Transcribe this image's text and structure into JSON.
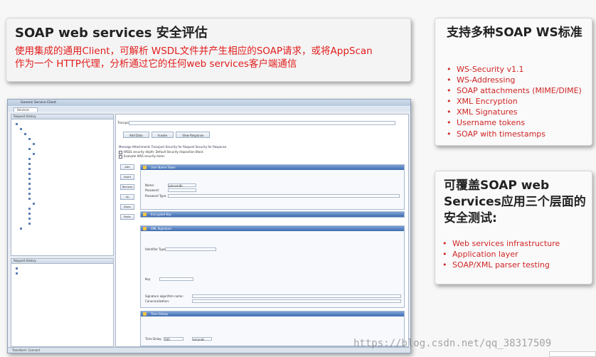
{
  "main_panel": {
    "title": "SOAP web services 安全评估",
    "desc_line1": "使用集成的通用Client，可解析 WSDL文件并产生相应的SOAP请求，或将AppScan",
    "desc_line2": "作为一个 HTTP代理，分析通过它的任何web services客户端通信"
  },
  "ws_panel": {
    "title": "支持多种SOAP WS标准",
    "items": [
      "WS-Security v1.1",
      "WS-Addressing",
      "SOAP attachments (MIME/DIME)",
      "XML Encryption",
      "XML Signatures",
      "Username tokens",
      "SOAP with timestamps"
    ]
  },
  "coverage_panel": {
    "title": "可覆盖SOAP web Services应用三个层面的安全测试:",
    "items": [
      "Web services infrastructure",
      "Application layer",
      "SOAP/XML parser testing"
    ]
  },
  "screenshot": {
    "window_title": "Generic Service Client",
    "tab": "Services",
    "left_header": "Request History",
    "history_header": "Request History",
    "right_transport": "Transport",
    "chevrons": [
      "Add Data",
      "Invoke",
      "View Response"
    ],
    "sub_tabs": "Message  Attachments  Transport  Security for Request  Security for Response",
    "checkboxes": [
      "WSDL security depth: Default Security disposition Block",
      "Evaluate WSS security items"
    ],
    "side_buttons": [
      "Add",
      "Insert",
      "Remove",
      "Up",
      "Down",
      "Paste"
    ],
    "sections": {
      "user_token": "User Name Token",
      "encrypted_key": "Encrypted Key",
      "xml_signature": "XML Signature",
      "time_stamp": "Time Stamp"
    },
    "user_fields": {
      "name_label": "Name:",
      "name_value": "johnsmith",
      "password_label": "Password:",
      "type_label": "Password Type:"
    },
    "signature_fields": {
      "method_label": "Signature algorithm name:",
      "canon_label": "Canonicalization:",
      "identifier_label": "Identifier Type:",
      "key_label": "Key:"
    },
    "timestamp_fields": {
      "ttl_label": "Time Delay:",
      "ttl_value": "200",
      "unit": "seconds"
    },
    "status": "Transform: Connect"
  },
  "watermark": "https://blog.csdn.net/qq_38317509"
}
